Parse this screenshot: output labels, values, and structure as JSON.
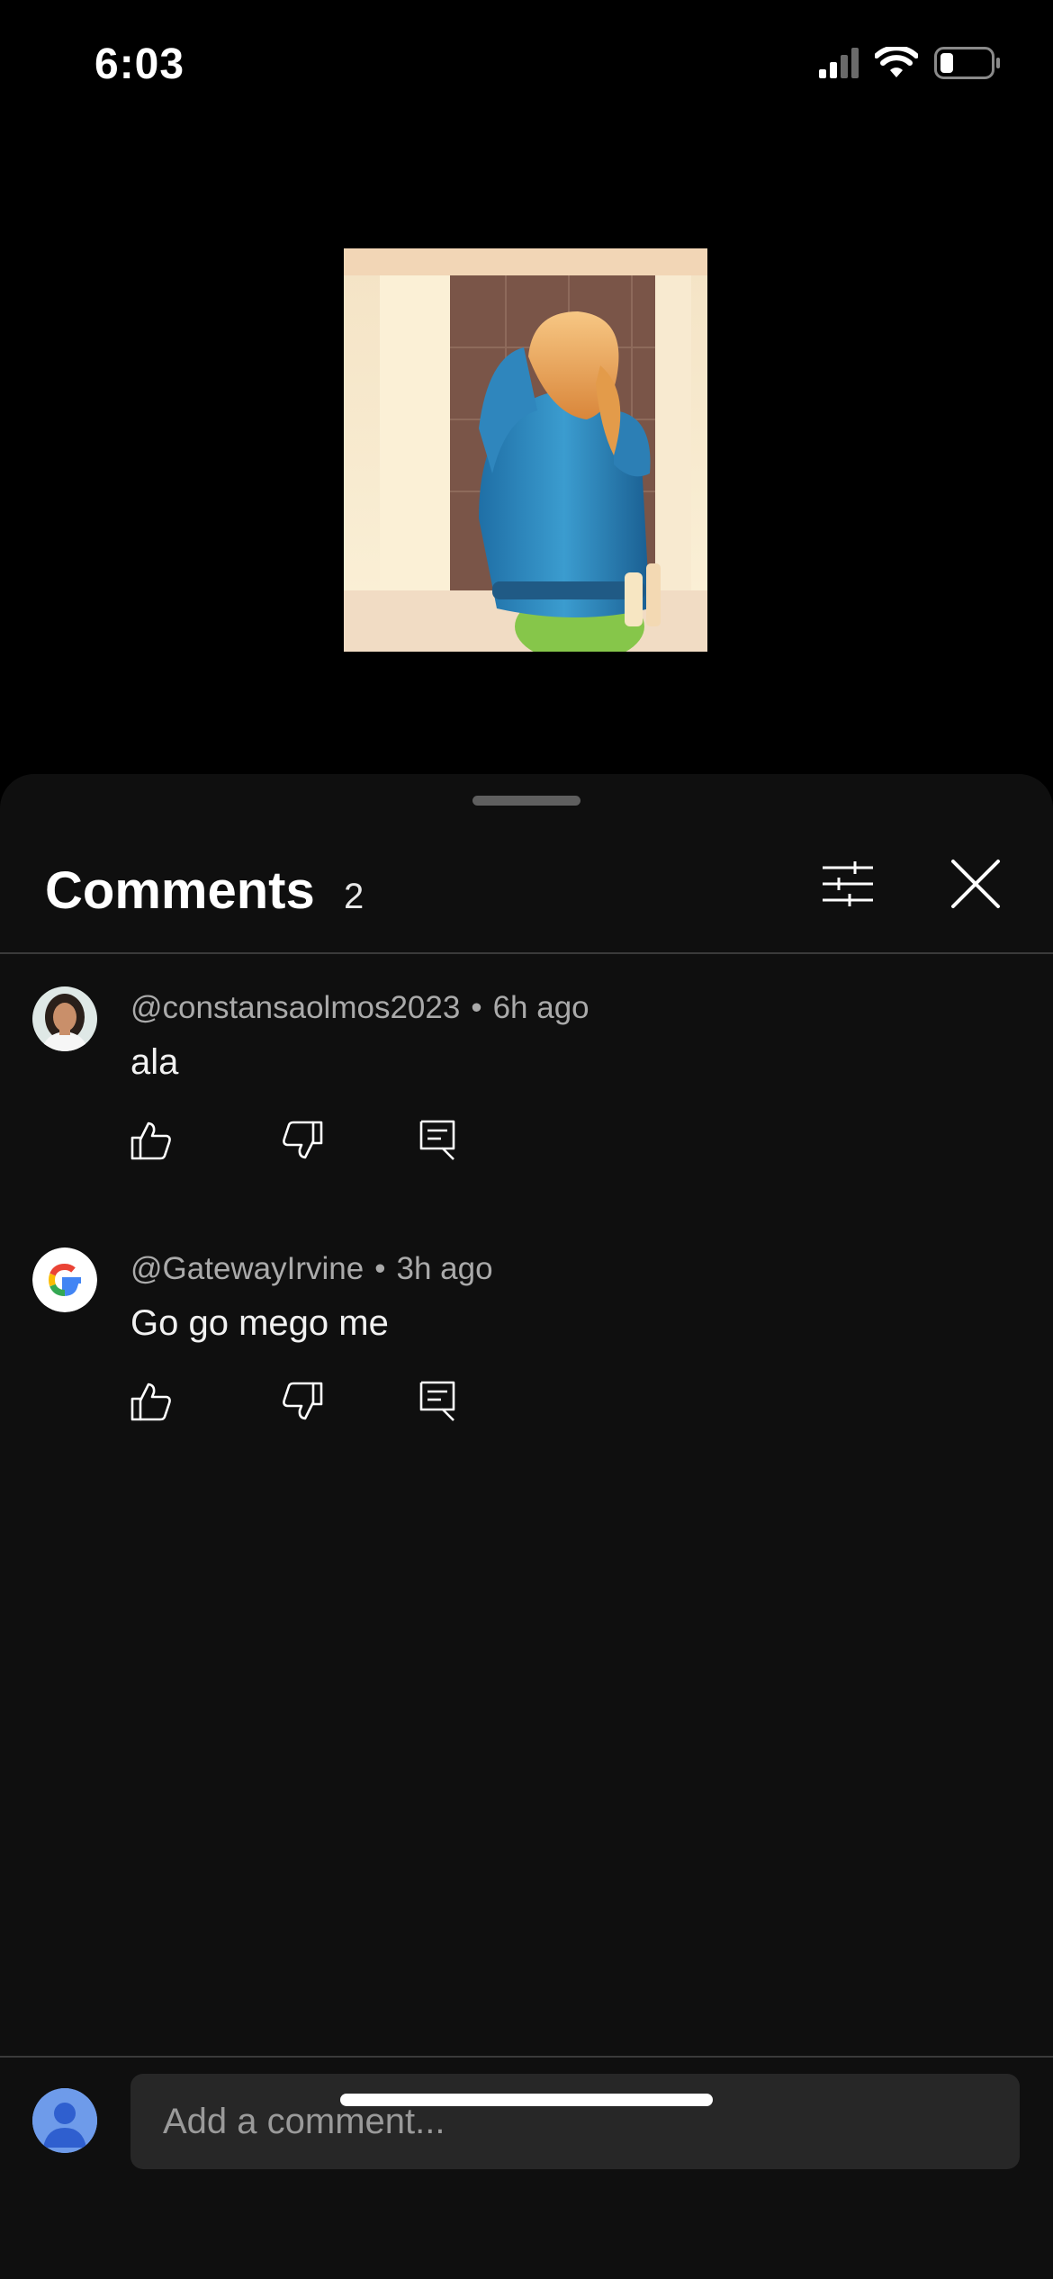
{
  "status_bar": {
    "time": "6:03",
    "icons": [
      "cellular-signal-icon",
      "wifi-icon",
      "battery-icon"
    ]
  },
  "video": {
    "thumbnail": "video-thumbnail-image"
  },
  "comments_panel": {
    "title": "Comments",
    "count": "2",
    "icons": {
      "filter": "filter-sliders-icon",
      "close": "close-icon"
    },
    "comments": [
      {
        "author": "@constansaolmos2023",
        "separator": "•",
        "time": "6h ago",
        "text": "ala",
        "avatar": "user-photo-avatar"
      },
      {
        "author": "@GatewayIrvine",
        "separator": "•",
        "time": "3h ago",
        "text": "Go go mego me",
        "avatar": "google-logo-avatar"
      }
    ],
    "composer": {
      "placeholder": "Add a comment..."
    }
  },
  "colors": {
    "background": "#000000",
    "sheet": "#0f0f0f",
    "secondary_text": "#aaaaaa",
    "input_bg": "#272727",
    "avatar_default": "#6e9bea"
  }
}
